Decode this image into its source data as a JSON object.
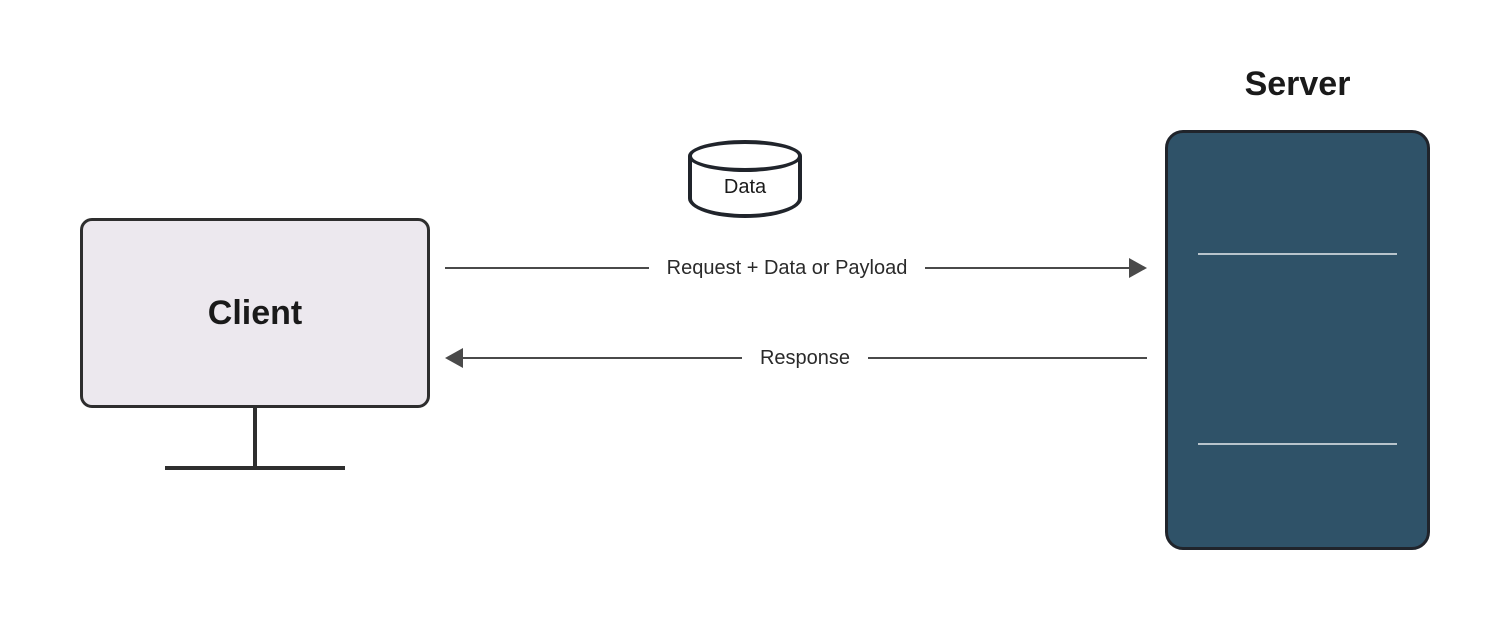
{
  "client": {
    "label": "Client"
  },
  "server": {
    "label": "Server"
  },
  "data": {
    "label": "Data"
  },
  "arrows": {
    "request": "Request + Data or Payload",
    "response": "Response"
  }
}
